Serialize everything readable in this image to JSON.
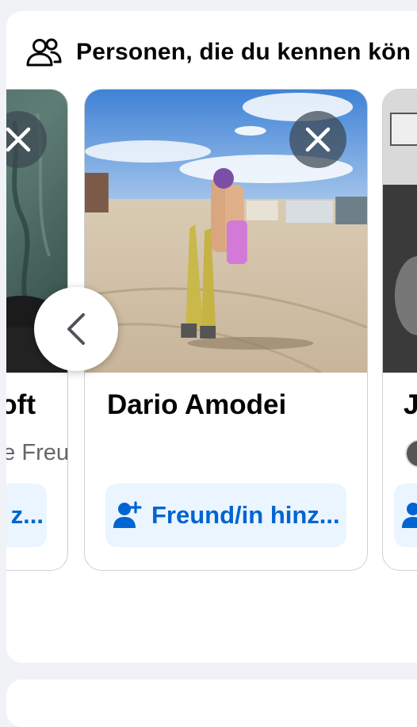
{
  "section": {
    "title": "Personen, die du kennen kön"
  },
  "cards": [
    {
      "name": "oft",
      "mutual": "e Freu",
      "add_label": "z..."
    },
    {
      "name": "Dario Amodei",
      "mutual": "",
      "add_label": "Freund/in hinz..."
    },
    {
      "name": "J",
      "mutual": "",
      "add_label": ""
    }
  ],
  "colors": {
    "accent": "#0064d1",
    "button_bg": "#ebf5ff",
    "page_bg": "#f0f2f5"
  },
  "icons": {
    "header": "people-icon",
    "close": "close-icon",
    "prev": "chevron-left-icon",
    "add_friend": "add-friend-icon"
  }
}
